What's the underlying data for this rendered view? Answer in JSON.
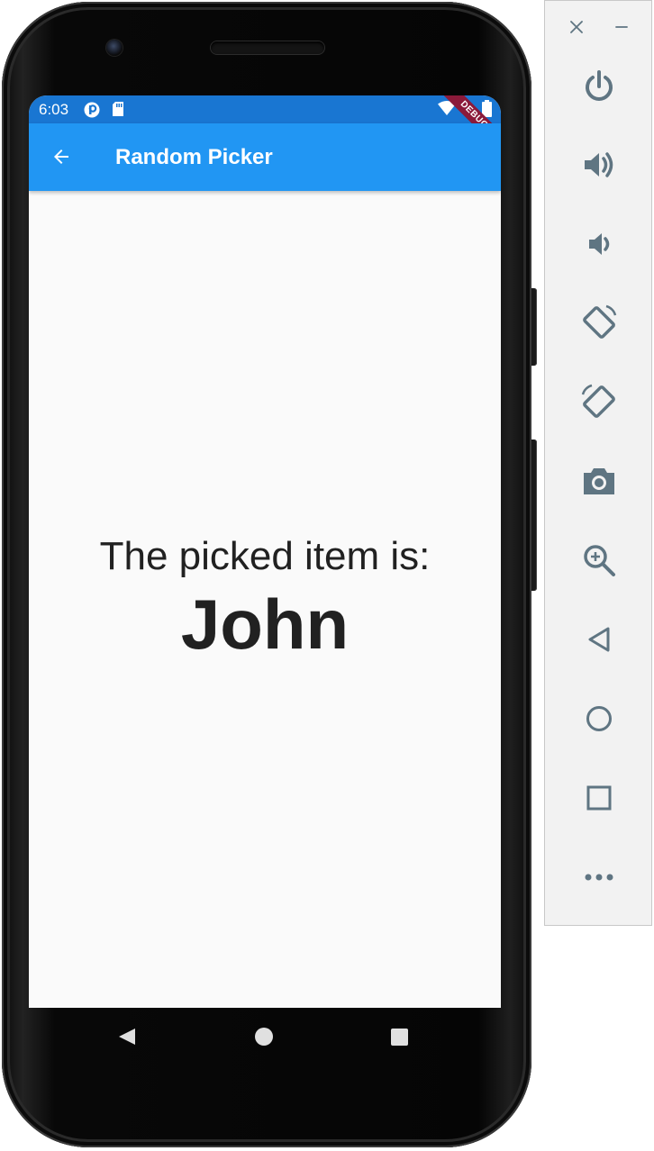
{
  "status_bar": {
    "time": "6:03",
    "icons": [
      "notification-app-icon",
      "sd-card-icon",
      "wifi-icon",
      "battery-icon"
    ]
  },
  "app_bar": {
    "back_icon": "arrow-back-icon",
    "title": "Random Picker",
    "debug_banner": "DEBUG",
    "color": "#2196f3",
    "status_color": "#1976d2"
  },
  "content": {
    "label": "The picked item is:",
    "value": "John"
  },
  "nav_bar": {
    "buttons": [
      "back-triangle-icon",
      "home-circle-icon",
      "recents-square-icon"
    ]
  },
  "emulator_toolbar": {
    "window_controls": [
      "close-icon",
      "minimize-icon"
    ],
    "tools": [
      "power-icon",
      "volume-up-icon",
      "volume-down-icon",
      "rotate-left-icon",
      "rotate-right-icon",
      "camera-icon",
      "zoom-icon",
      "back-icon",
      "home-icon",
      "overview-icon",
      "more-icon"
    ],
    "icon_color": "#5f7582"
  }
}
